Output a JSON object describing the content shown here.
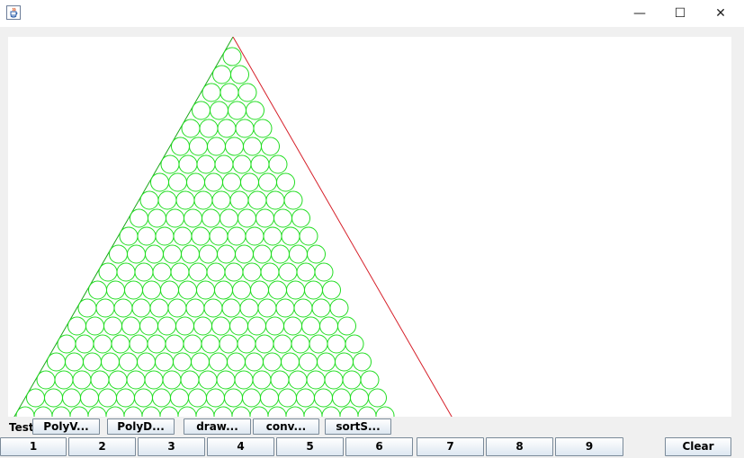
{
  "window": {
    "minimize_glyph": "—",
    "maximize_glyph": "☐",
    "close_glyph": "✕"
  },
  "toolbar": {
    "test_label": "Test",
    "buttons": [
      "PolyV...",
      "PolyD...",
      "draw...",
      "conv...",
      "sortS..."
    ]
  },
  "number_buttons": [
    "1",
    "2",
    "3",
    "4",
    "5",
    "6",
    "7",
    "8",
    "9"
  ],
  "clear_label": "Clear",
  "drawing": {
    "triangle_stroke": "#d6202a",
    "triangle_fill_stroke": "#1aa81a",
    "circle_stroke": "#22dd22",
    "rows_visible": 21
  },
  "colors": {
    "window_bg": "#f0f0f0",
    "canvas_bg": "#ffffff",
    "button_border": "#7a8a99"
  }
}
